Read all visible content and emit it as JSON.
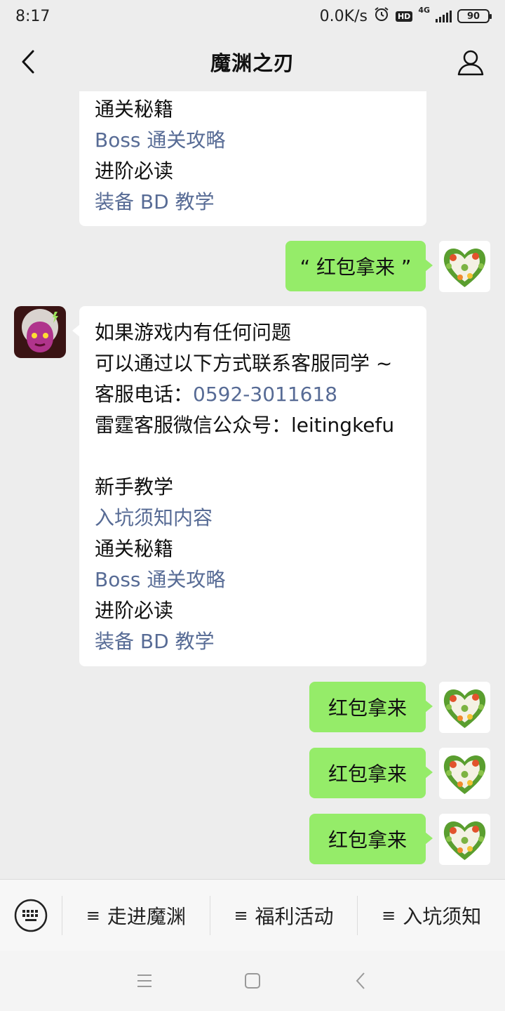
{
  "status_bar": {
    "time": "8:17",
    "net_speed": "0.0K/s",
    "hd_badge": "HD",
    "network": "4G",
    "battery": "90"
  },
  "header": {
    "title": "魔渊之刃"
  },
  "messages": {
    "m1": {
      "lines": [
        "通关秘籍",
        "Boss 通关攻略",
        "进阶必读",
        "装备 BD 教学"
      ]
    },
    "m2": {
      "text": "“ 红包拿来 ”"
    },
    "m3": {
      "line1": "如果游戏内有任何问题",
      "line2": "可以通过以下方式联系客服同学 ~",
      "phone_label": "客服电话：",
      "phone": "0592-3011618",
      "wechat_label": "雷霆客服微信公众号：",
      "wechat": "leitingkefu",
      "line5": "新手教学",
      "line6": "入坑须知内容",
      "line7": "通关秘籍",
      "line8": "Boss 通关攻略",
      "line9": "进阶必读",
      "line10": "装备 BD 教学"
    },
    "m4": {
      "text": "红包拿来"
    },
    "m5": {
      "text": "红包拿来"
    },
    "m6": {
      "text": "红包拿来"
    }
  },
  "menu": {
    "items": [
      {
        "icon": "≡",
        "label": "走进魔渊"
      },
      {
        "icon": "≡",
        "label": "福利活动"
      },
      {
        "icon": "≡",
        "label": "入坑须知"
      }
    ]
  },
  "colors": {
    "accent_link": "#576b95",
    "outgoing_bubble": "#95ec69",
    "background": "#ededed"
  },
  "icons": {
    "back": "chevron-left-icon",
    "profile": "person-icon",
    "keyboard": "keyboard-icon",
    "nav_menu": "menu-icon",
    "nav_home": "square-icon",
    "nav_back": "back-icon"
  }
}
